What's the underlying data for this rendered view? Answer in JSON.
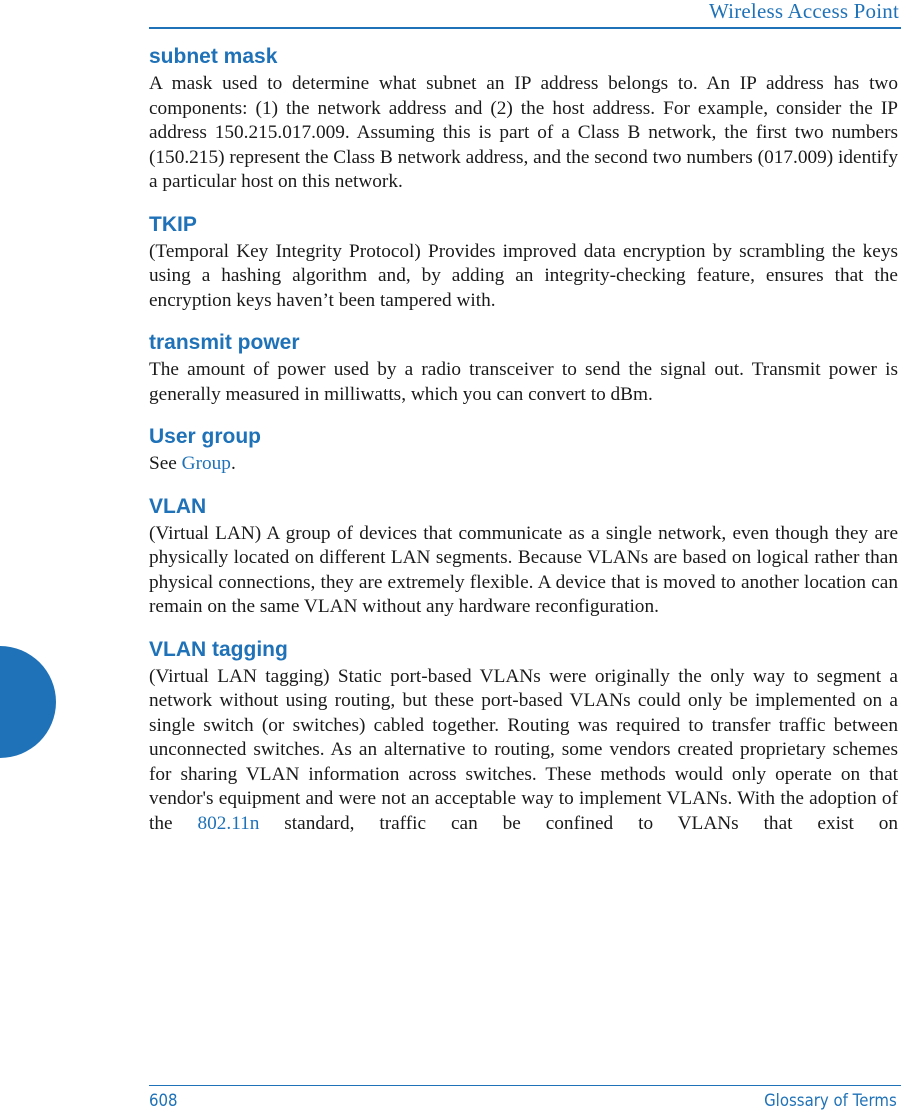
{
  "header": {
    "title": "Wireless Access Point"
  },
  "footer": {
    "page_number": "608",
    "section": "Glossary of Terms"
  },
  "colors": {
    "accent": "#1f72b8",
    "text": "#1a1a1a"
  },
  "entries": [
    {
      "term": "subnet mask",
      "definition": "A mask used to determine what subnet an IP address belongs to. An IP address has two components: (1) the network address and (2) the host address. For example, consider the IP address 150.215.017.009. Assuming this is part of a Class B network, the first two numbers (150.215) represent the Class B network address, and the second two numbers (017.009) identify a particular host on this network."
    },
    {
      "term": "TKIP",
      "definition": "(Temporal Key Integrity Protocol) Provides improved data encryption by scrambling the keys using a hashing algorithm and, by adding an integrity-checking feature, ensures that the encryption keys haven’t been tampered with."
    },
    {
      "term": "transmit power",
      "definition": "The amount of power used by a radio transceiver to send the signal out. Transmit power is generally measured in milliwatts, which you can convert to dBm."
    },
    {
      "term": "User group",
      "definition_prefix": "See ",
      "link": "Group",
      "definition_suffix": "."
    },
    {
      "term": "VLAN",
      "definition": "(Virtual LAN) A group of devices that communicate as a single network, even though they are physically located on different LAN segments. Because VLANs are based on logical rather than physical connections, they are extremely flexible. A device that is moved to another location can remain on the same VLAN without any hardware reconfiguration."
    },
    {
      "term": "VLAN tagging",
      "definition_prefix": "(Virtual LAN tagging) Static port-based VLANs were originally the only way to segment a network without using routing, but these port-based VLANs could only be implemented on a single switch (or switches) cabled together. Routing was required to transfer traffic between unconnected switches. As an alternative to routing, some vendors created proprietary schemes for sharing VLAN information across switches. These methods would only operate on that vendor's equipment and were not an acceptable way to implement VLANs. With the adoption of the ",
      "link": "802.11n",
      "definition_suffix": " standard, traffic can be confined to VLANs that exist on"
    }
  ]
}
